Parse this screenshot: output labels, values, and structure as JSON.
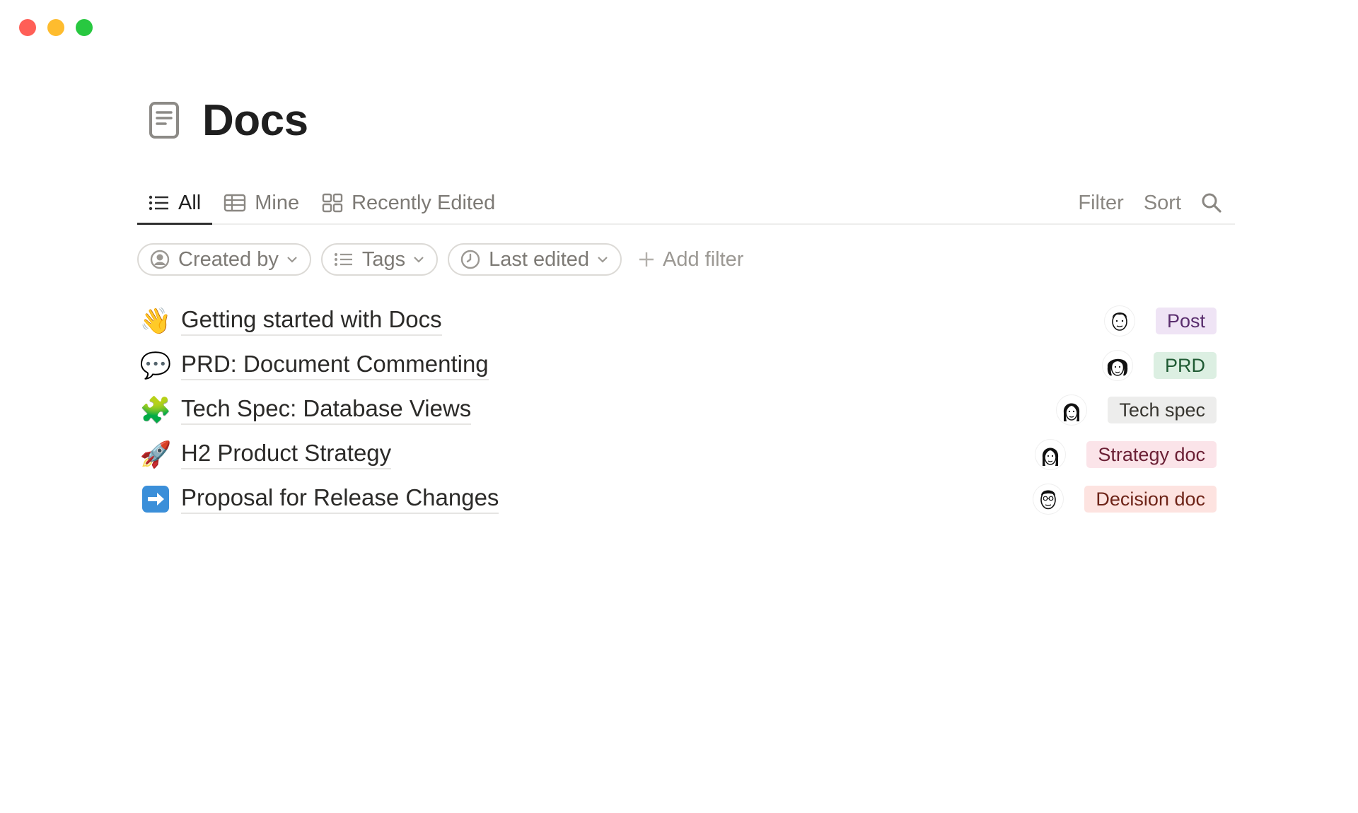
{
  "window": {
    "controls": [
      "close",
      "minimize",
      "zoom"
    ],
    "colors": {
      "close": "#ff5f57",
      "minimize": "#febc2e",
      "zoom": "#28c840"
    }
  },
  "page": {
    "title": "Docs",
    "icon": "document-icon"
  },
  "tabs": [
    {
      "label": "All",
      "icon": "list-icon",
      "active": true
    },
    {
      "label": "Mine",
      "icon": "table-icon",
      "active": false
    },
    {
      "label": "Recently Edited",
      "icon": "gallery-icon",
      "active": false
    }
  ],
  "toolbar": {
    "filter_label": "Filter",
    "sort_label": "Sort",
    "search_icon": "search-icon"
  },
  "filters": [
    {
      "label": "Created by",
      "icon": "person-icon"
    },
    {
      "label": "Tags",
      "icon": "list-icon"
    },
    {
      "label": "Last edited",
      "icon": "clock-icon"
    }
  ],
  "add_filter_label": "Add filter",
  "docs": [
    {
      "emoji": "👋",
      "title": "Getting started with Docs",
      "avatar": "avatar-man-short-hair",
      "tag": "Post",
      "tag_bg": "#efe4f5",
      "tag_color": "#5a2e6e"
    },
    {
      "emoji": "💬",
      "title": "PRD: Document Commenting",
      "avatar": "avatar-woman-curly-hair",
      "tag": "PRD",
      "tag_bg": "#dcefe2",
      "tag_color": "#1f5a33"
    },
    {
      "emoji": "🧩",
      "title": "Tech Spec: Database Views",
      "avatar": "avatar-woman-long-hair",
      "tag": "Tech spec",
      "tag_bg": "#ededec",
      "tag_color": "#37352f"
    },
    {
      "emoji": "🚀",
      "title": "H2 Product Strategy",
      "avatar": "avatar-woman-long-hair",
      "tag": "Strategy doc",
      "tag_bg": "#fbe4e9",
      "tag_color": "#6b2035"
    },
    {
      "emoji": "➡️",
      "title": "Proposal for Release Changes",
      "avatar": "avatar-man-glasses",
      "tag": "Decision doc",
      "tag_bg": "#fde3e0",
      "tag_color": "#6e2418"
    }
  ]
}
